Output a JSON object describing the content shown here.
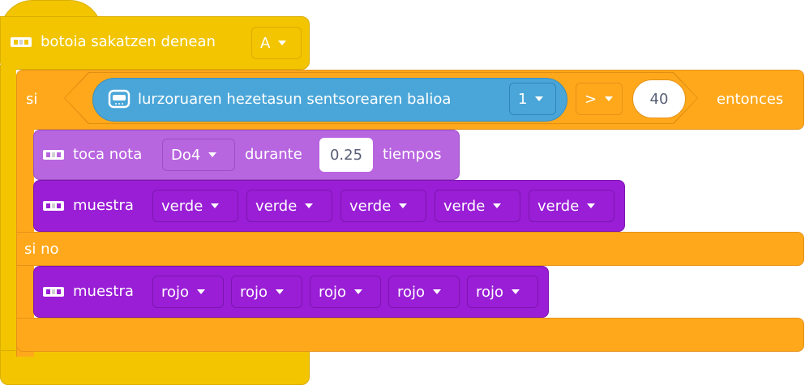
{
  "hat": {
    "label": "botoia sakatzen denean",
    "button": "A"
  },
  "if_block": {
    "if_label": "si",
    "then_label": "entonces",
    "else_label": "si no"
  },
  "condition": {
    "sensor_label": "lurzoruaren hezetasun sentsorearen balioa",
    "port": "1",
    "operator": ">",
    "value": "40"
  },
  "play_note": {
    "label": "toca nota",
    "note": "Do4",
    "during": "durante",
    "duration": "0.25",
    "beats": "tiempos"
  },
  "display_then": {
    "label": "muestra",
    "colors": [
      "verde",
      "verde",
      "verde",
      "verde",
      "verde"
    ]
  },
  "display_else": {
    "label": "muestra",
    "colors": [
      "rojo",
      "rojo",
      "rojo",
      "rojo",
      "rojo"
    ]
  },
  "icons": {
    "hub": "hub-icon",
    "sensor": "sensor-icon",
    "dropdown": "caret-down-icon"
  },
  "colors": {
    "event": "#f3c500",
    "control": "#ffa81b",
    "sensor": "#4aa6d8",
    "sound": "#b865e0",
    "light": "#9a1ed6"
  }
}
